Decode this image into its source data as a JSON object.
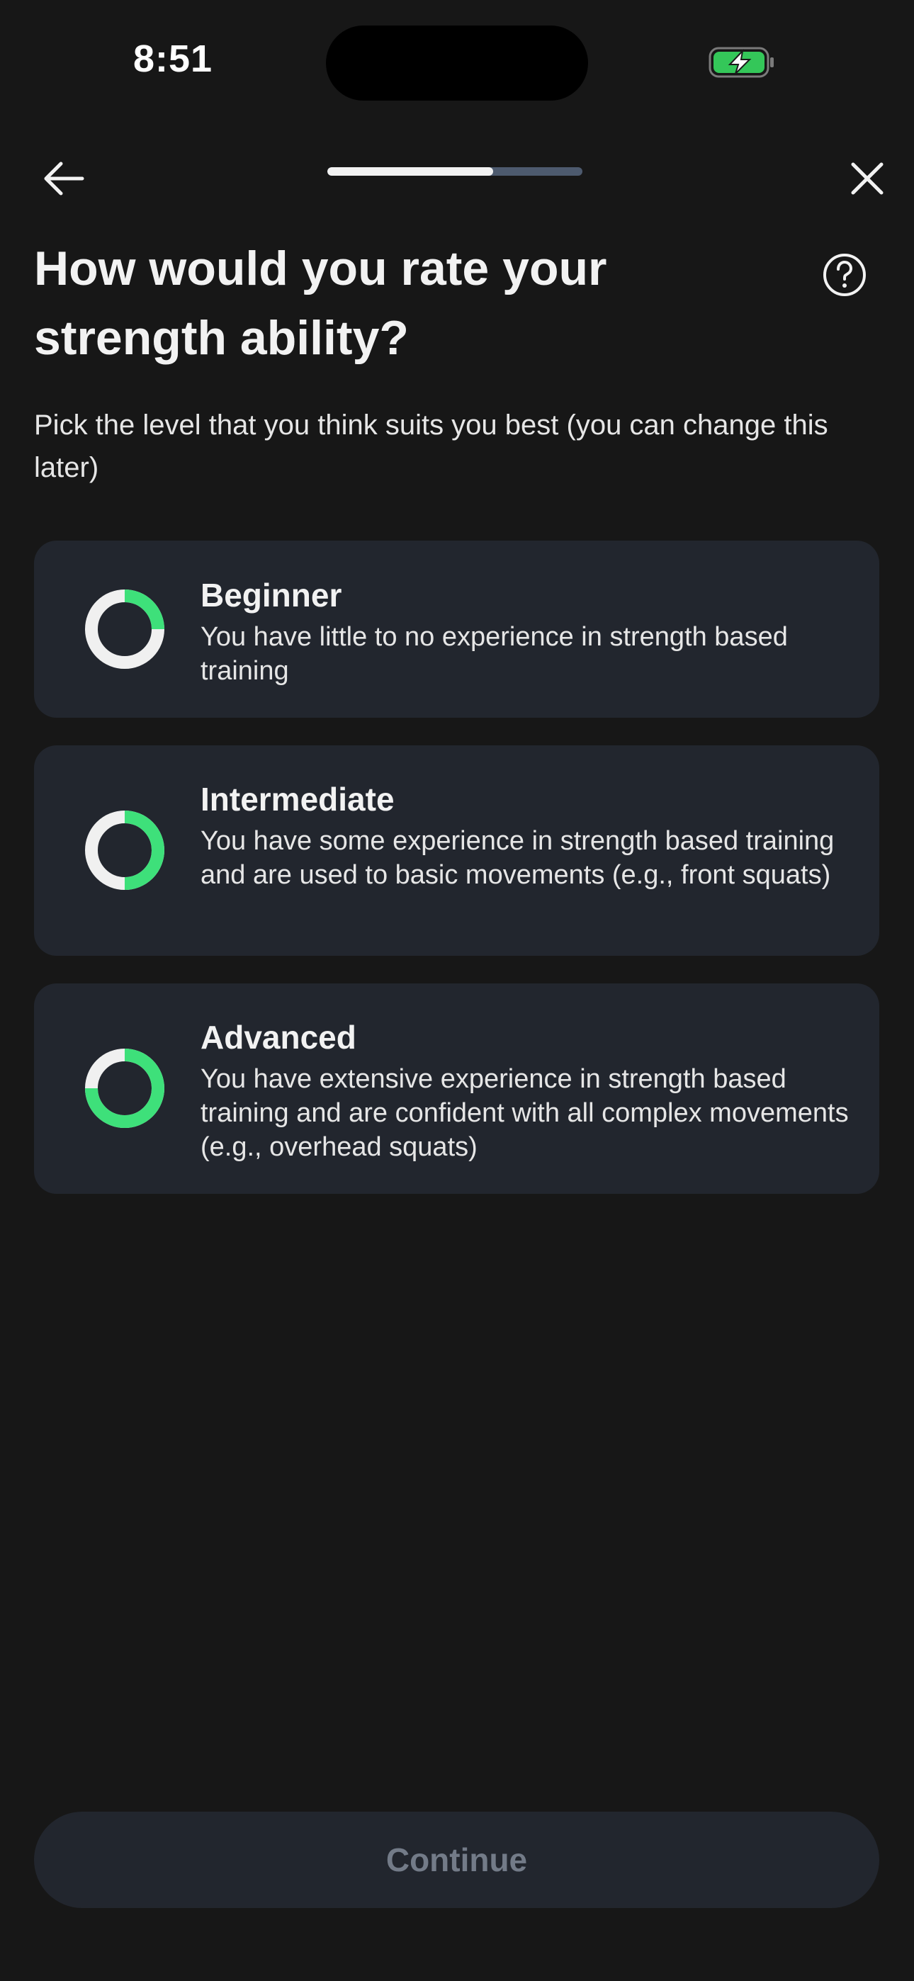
{
  "status_bar": {
    "time": "8:51",
    "battery_icon": "battery-charging-icon",
    "battery_color": "#34c759"
  },
  "nav": {
    "back_icon": "arrow-left-icon",
    "close_icon": "close-icon",
    "progress": 0.65
  },
  "question": {
    "title": "How would you rate your strength ability?",
    "subtitle": "Pick the level that you think suits you best (you can change this later)",
    "help_icon": "question-circle-icon"
  },
  "options": [
    {
      "title": "Beginner",
      "description": "You have little to no experience in strength based training",
      "level_fraction": 0.25
    },
    {
      "title": "Intermediate",
      "description": "You have some experience in strength based training and are used to basic movements (e.g., front squats)",
      "level_fraction": 0.5
    },
    {
      "title": "Advanced",
      "description": "You have extensive experience in strength based training and are confident with all complex movements (e.g., overhead squats)",
      "level_fraction": 0.75
    }
  ],
  "colors": {
    "background": "#171717",
    "card": "#22262e",
    "accent_green": "#3ee07a",
    "ring_base": "#f0f0f0",
    "button_text_disabled": "#737b88"
  },
  "continue_label": "Continue"
}
